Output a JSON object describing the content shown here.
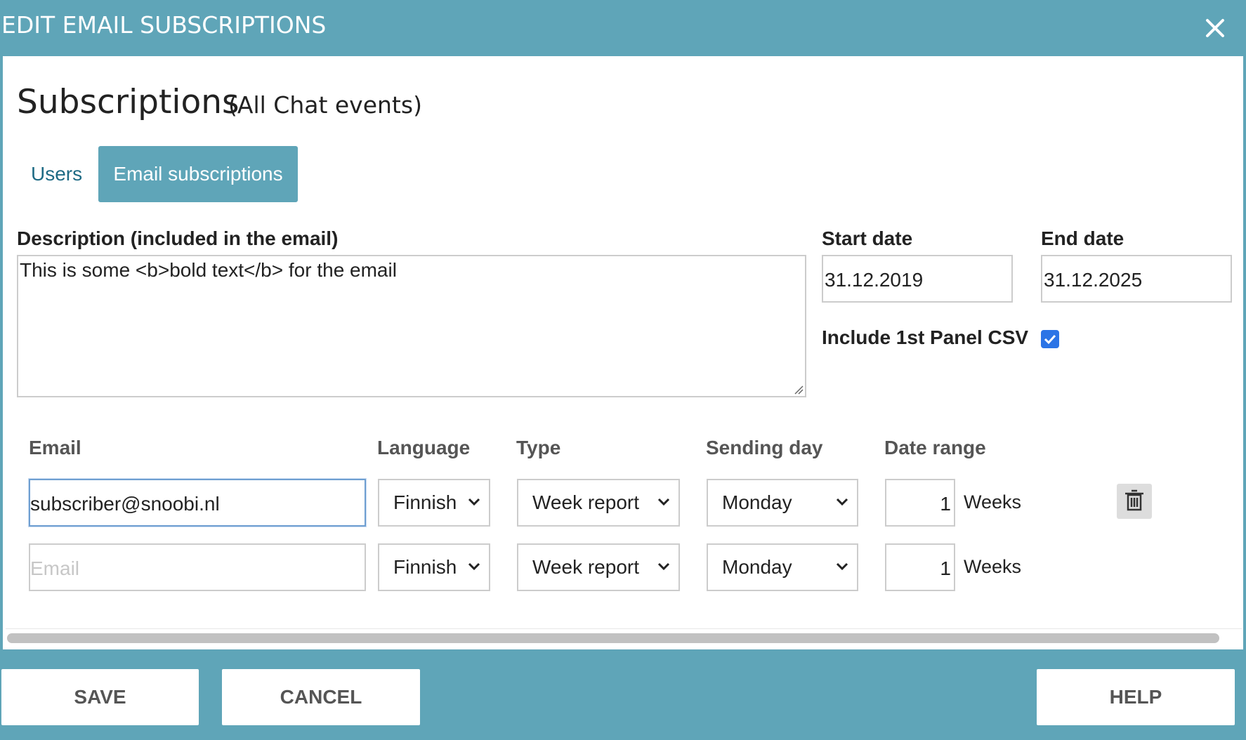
{
  "window": {
    "title": "EDIT EMAIL SUBSCRIPTIONS",
    "close_icon": "close-icon"
  },
  "header": {
    "heading": "Subscriptions",
    "subheading": "(All Chat events)"
  },
  "tabs": [
    {
      "label": "Users",
      "active": false
    },
    {
      "label": "Email subscriptions",
      "active": true
    }
  ],
  "form": {
    "description_label": "Description (included in the email)",
    "description_value": "This is some <b>bold text</b> for the email",
    "start_date_label": "Start date",
    "start_date_value": "31.12.2019",
    "end_date_label": "End date",
    "end_date_value": "31.12.2025",
    "include_csv_label": "Include 1st Panel CSV",
    "include_csv_checked": true
  },
  "table": {
    "headers": [
      "Email",
      "Language",
      "Type",
      "Sending day",
      "Date range"
    ],
    "rows": [
      {
        "email": "subscriber@snoobi.nl",
        "email_placeholder": "",
        "language": "Finnish",
        "type": "Week report",
        "sending_day": "Monday",
        "range_value": "1",
        "range_unit": "Weeks",
        "delete_icon": "trash-icon"
      },
      {
        "email": "",
        "email_placeholder": "Email",
        "language": "Finnish",
        "type": "Week report",
        "sending_day": "Monday",
        "range_value": "1",
        "range_unit": "Weeks"
      }
    ]
  },
  "footer": {
    "save_label": "SAVE",
    "cancel_label": "CANCEL",
    "help_label": "HELP"
  },
  "colors": {
    "accent": "#5fa5b8",
    "checkbox": "#2b74e6"
  }
}
